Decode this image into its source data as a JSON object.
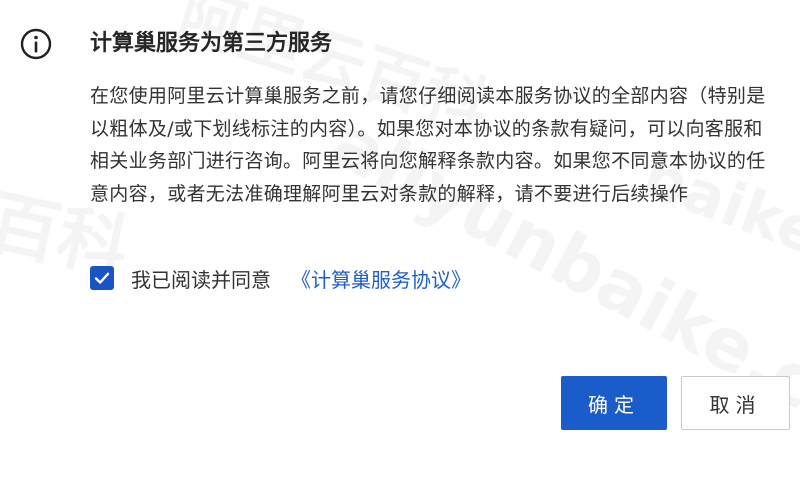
{
  "dialog": {
    "title": "计算巢服务为第三方服务",
    "body": "在您使用阿里云计算巢服务之前，请您仔细阅读本服务协议的全部内容（特别是以粗体及/或下划线标注的内容）。如果您对本协议的条款有疑问，可以向客服和相关业务部门进行咨询。阿里云将向您解释条款内容。如果您不同意本协议的任意内容，或者无法准确理解阿里云对条款的解释，请不要进行后续操作",
    "agree_label": "我已阅读并同意",
    "agree_link": "《计算巢服务协议》",
    "agree_checked": true,
    "ok_label": "确定",
    "cancel_label": "取消"
  },
  "watermark": {
    "line1": "阿里云百科",
    "line2": "百科",
    "line3": "aliyunbaike.com",
    "line4": "baike"
  },
  "icons": {
    "info": "info-circle-icon",
    "check": "checkmark-icon"
  },
  "colors": {
    "primary": "#1a5cc9",
    "link": "#2060c8",
    "checkbox": "#1a53c3"
  }
}
